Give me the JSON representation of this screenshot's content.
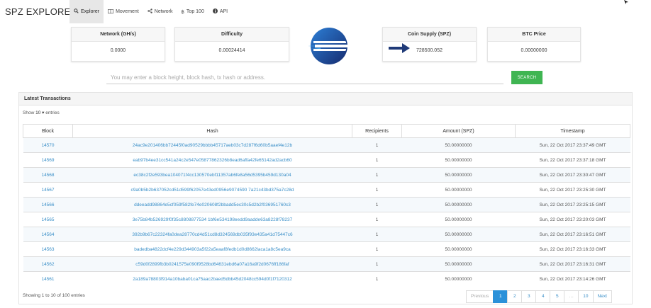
{
  "app": {
    "brand": "SPZ EXPLORER"
  },
  "nav": [
    {
      "label": "Explorer",
      "icon": "search-icon",
      "active": true
    },
    {
      "label": "Movement",
      "icon": "columns-icon",
      "active": false
    },
    {
      "label": "Network",
      "icon": "share-icon",
      "active": false
    },
    {
      "label": "Top 100",
      "icon": "bitcoin-icon",
      "active": false
    },
    {
      "label": "API",
      "icon": "info-icon",
      "active": false
    }
  ],
  "stats": {
    "network": {
      "label": "Network (GH/s)",
      "value": "0.0000"
    },
    "difficulty": {
      "label": "Difficulty",
      "value": "0.00024414"
    },
    "supply": {
      "label": "Coin Supply (SPZ)",
      "value": "728500.052"
    },
    "btc": {
      "label": "BTC Price",
      "value": "0.00000000"
    }
  },
  "search": {
    "placeholder": "You may enter a block height, block hash, tx hash or address.",
    "button": "SEARCH"
  },
  "transactions": {
    "title": "Latest Transactions",
    "show_prefix": "Show",
    "show_value": "10",
    "show_suffix": "entries",
    "columns": [
      "Block",
      "Hash",
      "Recipients",
      "Amount (SPZ)",
      "Timestamp"
    ],
    "rows": [
      {
        "block": "14570",
        "hash": "24ac9e201406bb72445f0ad90529bbbb45717aeb03c7d287f6d60b5aaef4e12b",
        "recipients": "1",
        "amount": "50.00000000",
        "timestamp": "Sun, 22 Oct 2017 23:37:49 GMT"
      },
      {
        "block": "14569",
        "hash": "eab97b4ee31cc541a24c2e547e05877862326b8ead6affa42fe65142ad2acb60",
        "recipients": "1",
        "amount": "50.00000000",
        "timestamp": "Sun, 22 Oct 2017 23:37:18 GMT"
      },
      {
        "block": "14568",
        "hash": "ec38c2f2e593bea104071f4cc130570ebf11357ab6fe8a56d5395b459d130a04",
        "recipients": "1",
        "amount": "50.00000000",
        "timestamp": "Sun, 22 Oct 2017 23:30:47 GMT"
      },
      {
        "block": "14567",
        "hash": "c9a0b5b2b637052cd51d599f62057e43ed0956e9074590 7a21c43bd375a7c28d",
        "recipients": "1",
        "amount": "50.00000000",
        "timestamp": "Sun, 22 Oct 2017 23:25:30 GMT"
      },
      {
        "block": "14566",
        "hash": "ddeeadd98864e5cf059f582fe74e020608f2bbadd5ec30c5d2b2f036951760c3",
        "recipients": "1",
        "amount": "50.00000000",
        "timestamp": "Sun, 22 Oct 2017 23:25:15 GMT"
      },
      {
        "block": "14565",
        "hash": "3e75b84b526929f0f35c8808877534 1bf6e534198eedd9aadde63a8228f78237",
        "recipients": "1",
        "amount": "50.00000000",
        "timestamp": "Sun, 22 Oct 2017 23:20:03 GMT"
      },
      {
        "block": "14564",
        "hash": "392b9b67c22324fa0dea28770cd4d51cd8d324569db035f93e435a41d75447c6",
        "recipients": "1",
        "amount": "50.00000000",
        "timestamp": "Sun, 22 Oct 2017 23:16:51 GMT"
      },
      {
        "block": "14563",
        "hash": "badedba4822dcf4e229d344903a5f22a5eaaf8fedb1d0d8662laca1a8c5ea9ca",
        "recipients": "1",
        "amount": "50.00000000",
        "timestamp": "Sun, 22 Oct 2017 23:16:33 GMT"
      },
      {
        "block": "14562",
        "hash": "c59d0f2899fb3b0241575e090f9528bd64631ebd6a07a16a9f2d0676ff186faf",
        "recipients": "1",
        "amount": "50.00000000",
        "timestamp": "Sun, 22 Oct 2017 23:16:31 GMT"
      },
      {
        "block": "14561",
        "hash": "2a189a78803f914a10baba01ca75aac2baed5dbb45d2048cc594d0f1f7120312",
        "recipients": "1",
        "amount": "50.00000000",
        "timestamp": "Sun, 22 Oct 2017 23:14:26 GMT"
      }
    ],
    "showing": "Showing 1 to 10 of 100 entries",
    "pagination": [
      "Previous",
      "1",
      "2",
      "3",
      "4",
      "5",
      "…",
      "10",
      "Next"
    ],
    "current_page": "1"
  },
  "colors": {
    "accent_green": "#3fb552",
    "link_blue": "#3a8fc8",
    "page_active": "#2b91d9",
    "arrow_navy": "#1f3a78"
  }
}
